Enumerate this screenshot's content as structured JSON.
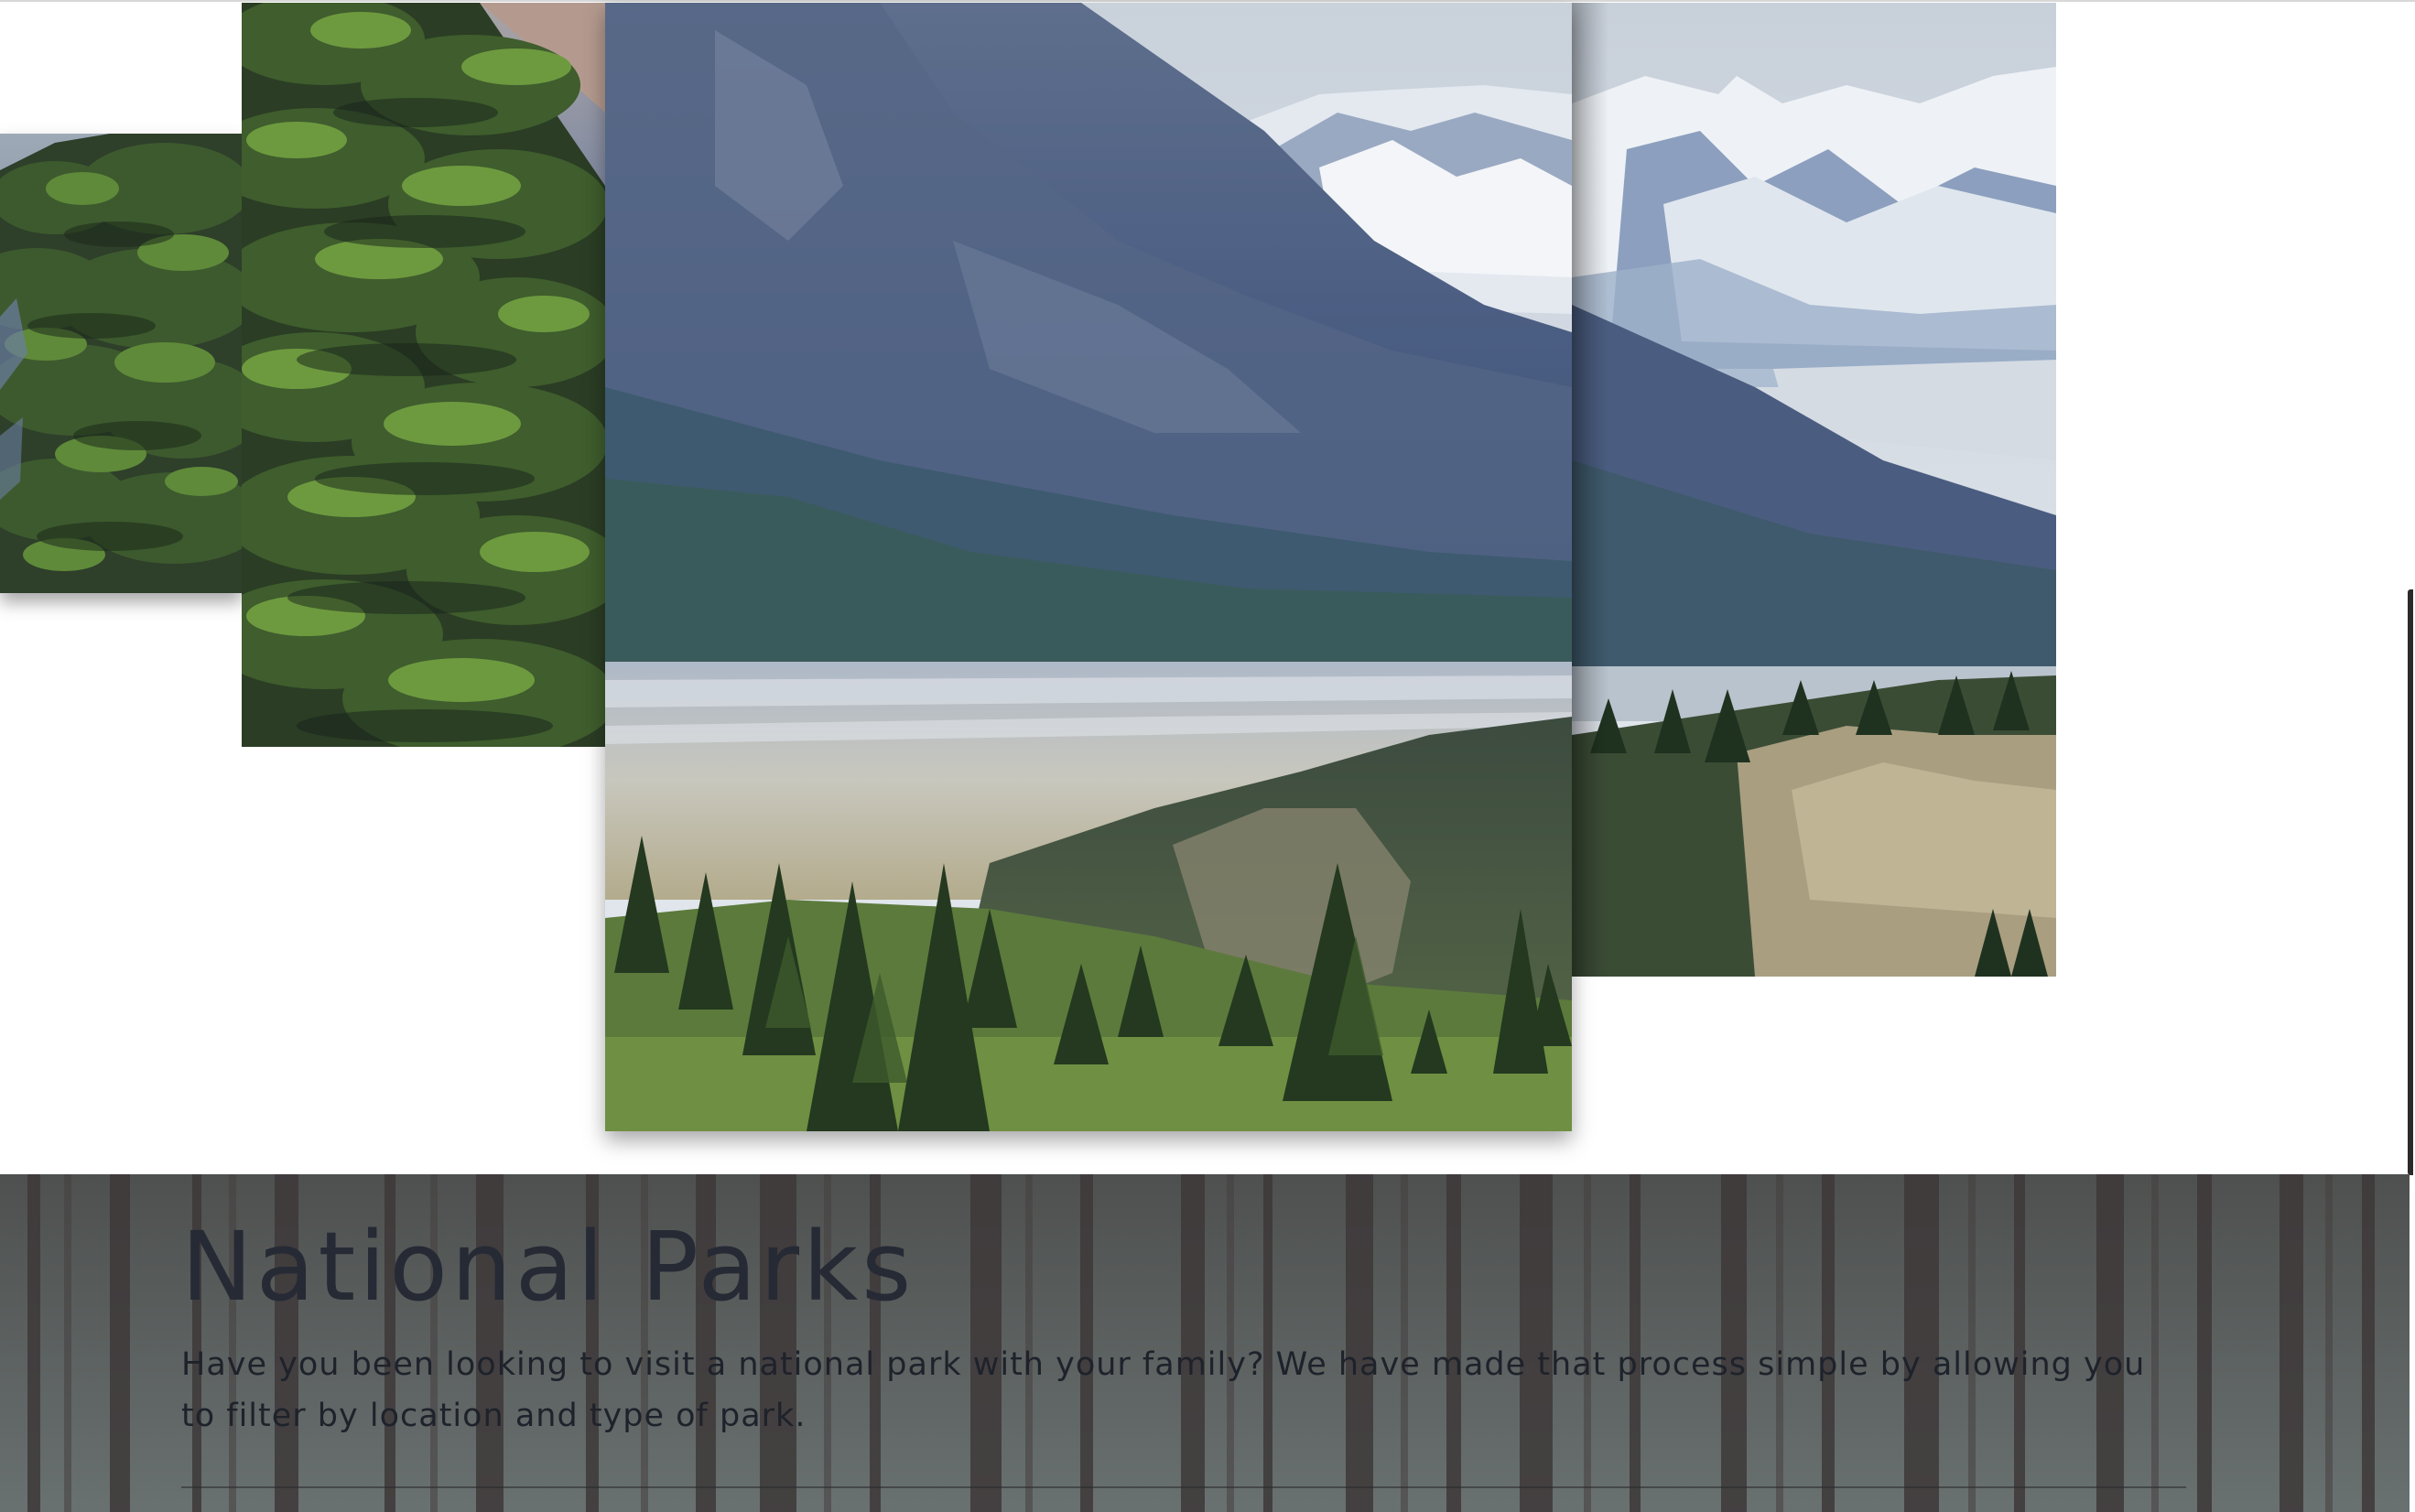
{
  "hero": {
    "title": "National Parks",
    "description": "Have you been looking to visit a national park with your family? We have made that process simple by allowing you to filter by location and type of park."
  },
  "gallery": {
    "images": [
      "left-tree-image",
      "tree-image",
      "mountain-valley-image",
      "snowy-peaks-image"
    ]
  },
  "colors": {
    "hero_overlay": "#4e4849",
    "title_text": "#262a35",
    "body_text": "#1e222b",
    "page_background": "#ffffff"
  }
}
